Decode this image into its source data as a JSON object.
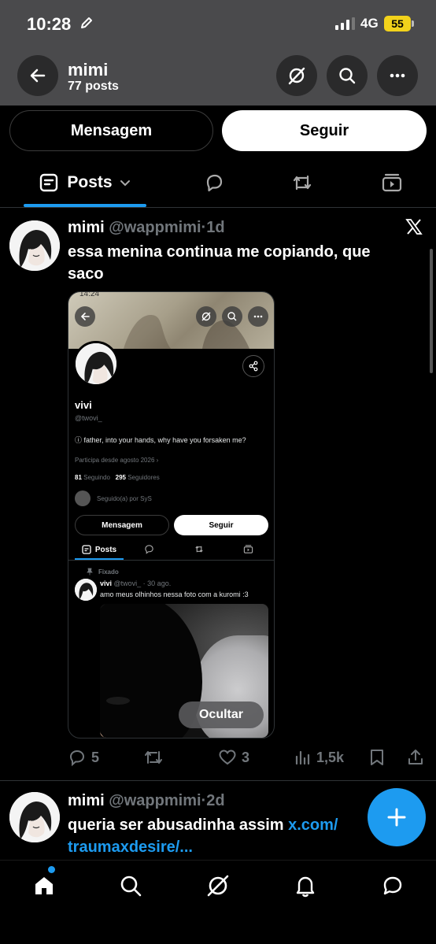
{
  "status_bar": {
    "time": "10:28",
    "network": "4G",
    "battery": "55"
  },
  "header": {
    "title": "mimi",
    "subtitle": "77 posts"
  },
  "profile_actions": {
    "message_label": "Mensagem",
    "follow_label": "Seguir"
  },
  "tabs": {
    "posts_label": "Posts"
  },
  "post1": {
    "name": "mimi",
    "handle": "@wappmimi",
    "separator": "·",
    "time": "1d",
    "text": "essa menina continua me copiando, que saco",
    "media": {
      "status_time": "14:24",
      "profile_name": "vivi",
      "profile_handle": "@twovi_",
      "bio": "ⓘ father, into your hands, why have you forsaken me?",
      "joined": "Participa desde agosto 2026",
      "following_count": "81",
      "following_label": "Seguindo",
      "followers_count": "295",
      "followers_label": "Seguidores",
      "followed_by": "Seguido(a) por SyS",
      "message_label": "Mensagem",
      "follow_label": "Seguir",
      "posts_tab": "Posts",
      "pinned_label": "Fixado",
      "post_name": "vivi",
      "post_meta": "@twovi_ · 30 ago.",
      "post_text": "amo meus olhinhos nessa foto com a kuromi :3"
    },
    "hide_label": "Ocultar",
    "replies": "5",
    "likes": "3",
    "views": "1,5k"
  },
  "post2": {
    "name": "mimi",
    "handle": "@wappmimi",
    "separator": "·",
    "time": "2d",
    "text": "queria ser abusadinha assim ",
    "link": "x.com/ traumaxdesire/..."
  },
  "colors": {
    "accent": "#1d9bf0",
    "background": "#000000",
    "muted": "#71767b",
    "battery": "#f2d21b"
  }
}
